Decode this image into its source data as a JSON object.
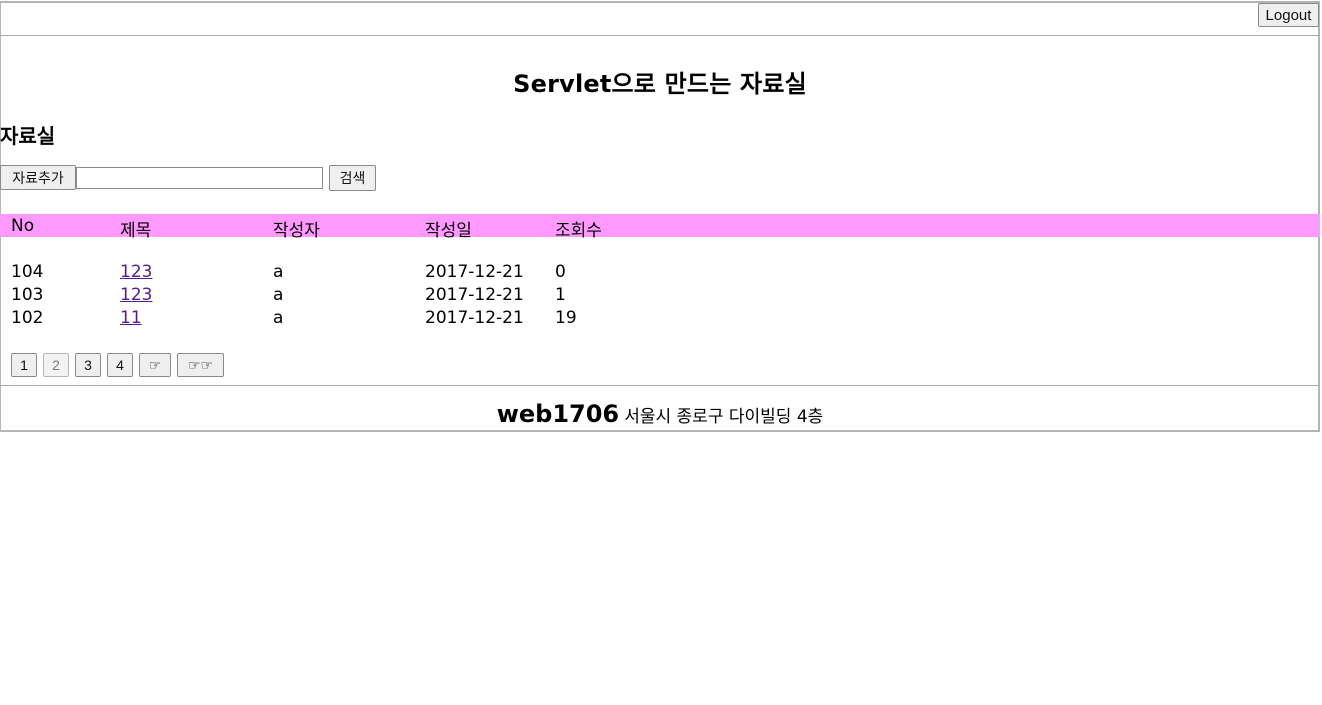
{
  "header": {
    "logout_label": "Logout"
  },
  "page_title": "Servlet으로 만드는 자료실",
  "section_title": "자료실",
  "toolbar": {
    "add_label": "자료추가",
    "search_value": "",
    "search_label": "검색"
  },
  "table": {
    "columns": [
      "No",
      "제목",
      "작성자",
      "작성일",
      "조회수"
    ],
    "rows": [
      {
        "no": "104",
        "title": "123",
        "author": "a",
        "date": "2017-12-21",
        "views": "0"
      },
      {
        "no": "103",
        "title": "123",
        "author": "a",
        "date": "2017-12-21",
        "views": "1"
      },
      {
        "no": "102",
        "title": "11",
        "author": "a",
        "date": "2017-12-21",
        "views": "19"
      }
    ],
    "header_bg": "#ff99ff",
    "link_color": "#551a8b"
  },
  "pagination": {
    "pages": [
      "1",
      "2",
      "3",
      "4"
    ],
    "current_page": "2",
    "next_label": "☞",
    "last_label": "☞☞"
  },
  "footer": {
    "site_name": "web1706",
    "address": "서울시 종로구 다이빌딩 4층"
  }
}
